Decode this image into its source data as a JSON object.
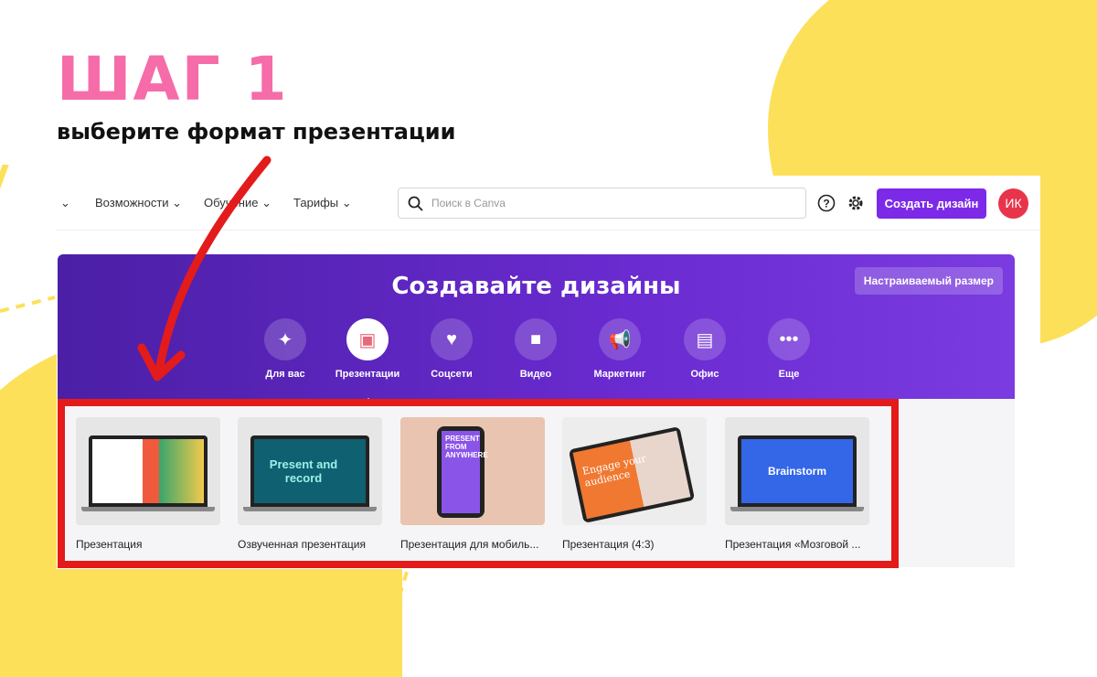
{
  "slide": {
    "title": "ШАГ 1",
    "subtitle": "выберите формат презентации"
  },
  "colors": {
    "title": "#f56ca8",
    "accent": "#7d2ae8",
    "highlight": "#e31b1b",
    "blob": "#fde05a"
  },
  "nav": {
    "items": [
      "Возможности",
      "Обучение",
      "Тарифы"
    ],
    "search_placeholder": "Поиск в Canva",
    "create_label": "Создать дизайн",
    "avatar": "ИК",
    "help_icon": "question-icon",
    "settings_icon": "gear-icon"
  },
  "banner": {
    "title": "Создавайте дизайны",
    "custom_size": "Настраиваемый размер",
    "categories": [
      {
        "label": "Для вас",
        "icon": "sparkle-icon"
      },
      {
        "label": "Презентации",
        "icon": "presentation-icon",
        "active": true
      },
      {
        "label": "Соцсети",
        "icon": "heart-bubble-icon"
      },
      {
        "label": "Видео",
        "icon": "video-camera-icon"
      },
      {
        "label": "Маркетинг",
        "icon": "megaphone-icon"
      },
      {
        "label": "Офис",
        "icon": "briefcase-icon"
      },
      {
        "label": "Еще",
        "icon": "more-icon"
      }
    ]
  },
  "templates": [
    {
      "label": "Презентация",
      "thumb_text": ""
    },
    {
      "label": "Озвученная презентация",
      "thumb_text": "Present and record"
    },
    {
      "label": "Презентация для мобиль...",
      "thumb_text": "PRESENT FROM ANYWHERE"
    },
    {
      "label": "Презентация (4:3)",
      "thumb_text": "Engage your audience"
    },
    {
      "label": "Презентация «Мозговой ...",
      "thumb_text": "Brainstorm"
    }
  ]
}
